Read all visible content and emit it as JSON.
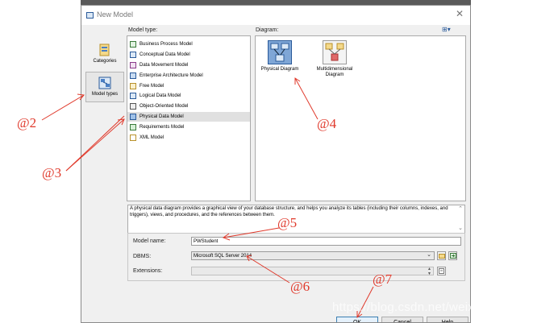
{
  "window": {
    "title": "New Model",
    "close_glyph": "✕"
  },
  "categories": [
    {
      "label": "Categories",
      "icon": "categories-icon",
      "selected": false
    },
    {
      "label": "Model types",
      "icon": "model-types-icon",
      "selected": true
    }
  ],
  "model_type": {
    "label": "Model type:",
    "items": [
      {
        "label": "Business Process Model",
        "icon": "business-process-icon"
      },
      {
        "label": "Conceptual Data Model",
        "icon": "conceptual-data-icon"
      },
      {
        "label": "Data Movement Model",
        "icon": "data-movement-icon"
      },
      {
        "label": "Enterprise Architecture Model",
        "icon": "enterprise-architecture-icon"
      },
      {
        "label": "Free Model",
        "icon": "free-model-icon"
      },
      {
        "label": "Logical Data Model",
        "icon": "logical-data-icon"
      },
      {
        "label": "Object-Oriented Model",
        "icon": "object-oriented-icon"
      },
      {
        "label": "Physical Data Model",
        "icon": "physical-data-icon",
        "selected": true
      },
      {
        "label": "Requirements Model",
        "icon": "requirements-icon"
      },
      {
        "label": "XML Model",
        "icon": "xml-model-icon"
      }
    ]
  },
  "diagram": {
    "label": "Diagram:",
    "view_toggle": "⊞▾",
    "items": [
      {
        "label": "Physical Diagram",
        "icon": "physical-diagram-icon",
        "selected": true
      },
      {
        "label": "Multidimensional Diagram",
        "icon": "multidimensional-diagram-icon"
      }
    ]
  },
  "description": "A physical data diagram provides a graphical view of your database structure, and helps you analyze its tables (including their columns, indexes, and triggers), views, and procedures, and the references between them.",
  "form": {
    "model_name": {
      "label": "Model name:",
      "value": "PWStudent"
    },
    "dbms": {
      "label": "DBMS:",
      "value": "Microsoft SQL Server 2014"
    },
    "extensions": {
      "label": "Extensions:",
      "value": ""
    }
  },
  "buttons": {
    "ok": "OK",
    "cancel": "Cancel",
    "help": "Help"
  },
  "annotations": [
    {
      "label": "@2"
    },
    {
      "label": "@3"
    },
    {
      "label": "@4"
    },
    {
      "label": "@5"
    },
    {
      "label": "@6"
    },
    {
      "label": "@7"
    }
  ],
  "watermark": "https://blog.csdn.net/weixin_57772003",
  "colors": {
    "annotation": "#e0392b",
    "selection": "#e0e0e0",
    "accent": "#2a5a9a"
  }
}
